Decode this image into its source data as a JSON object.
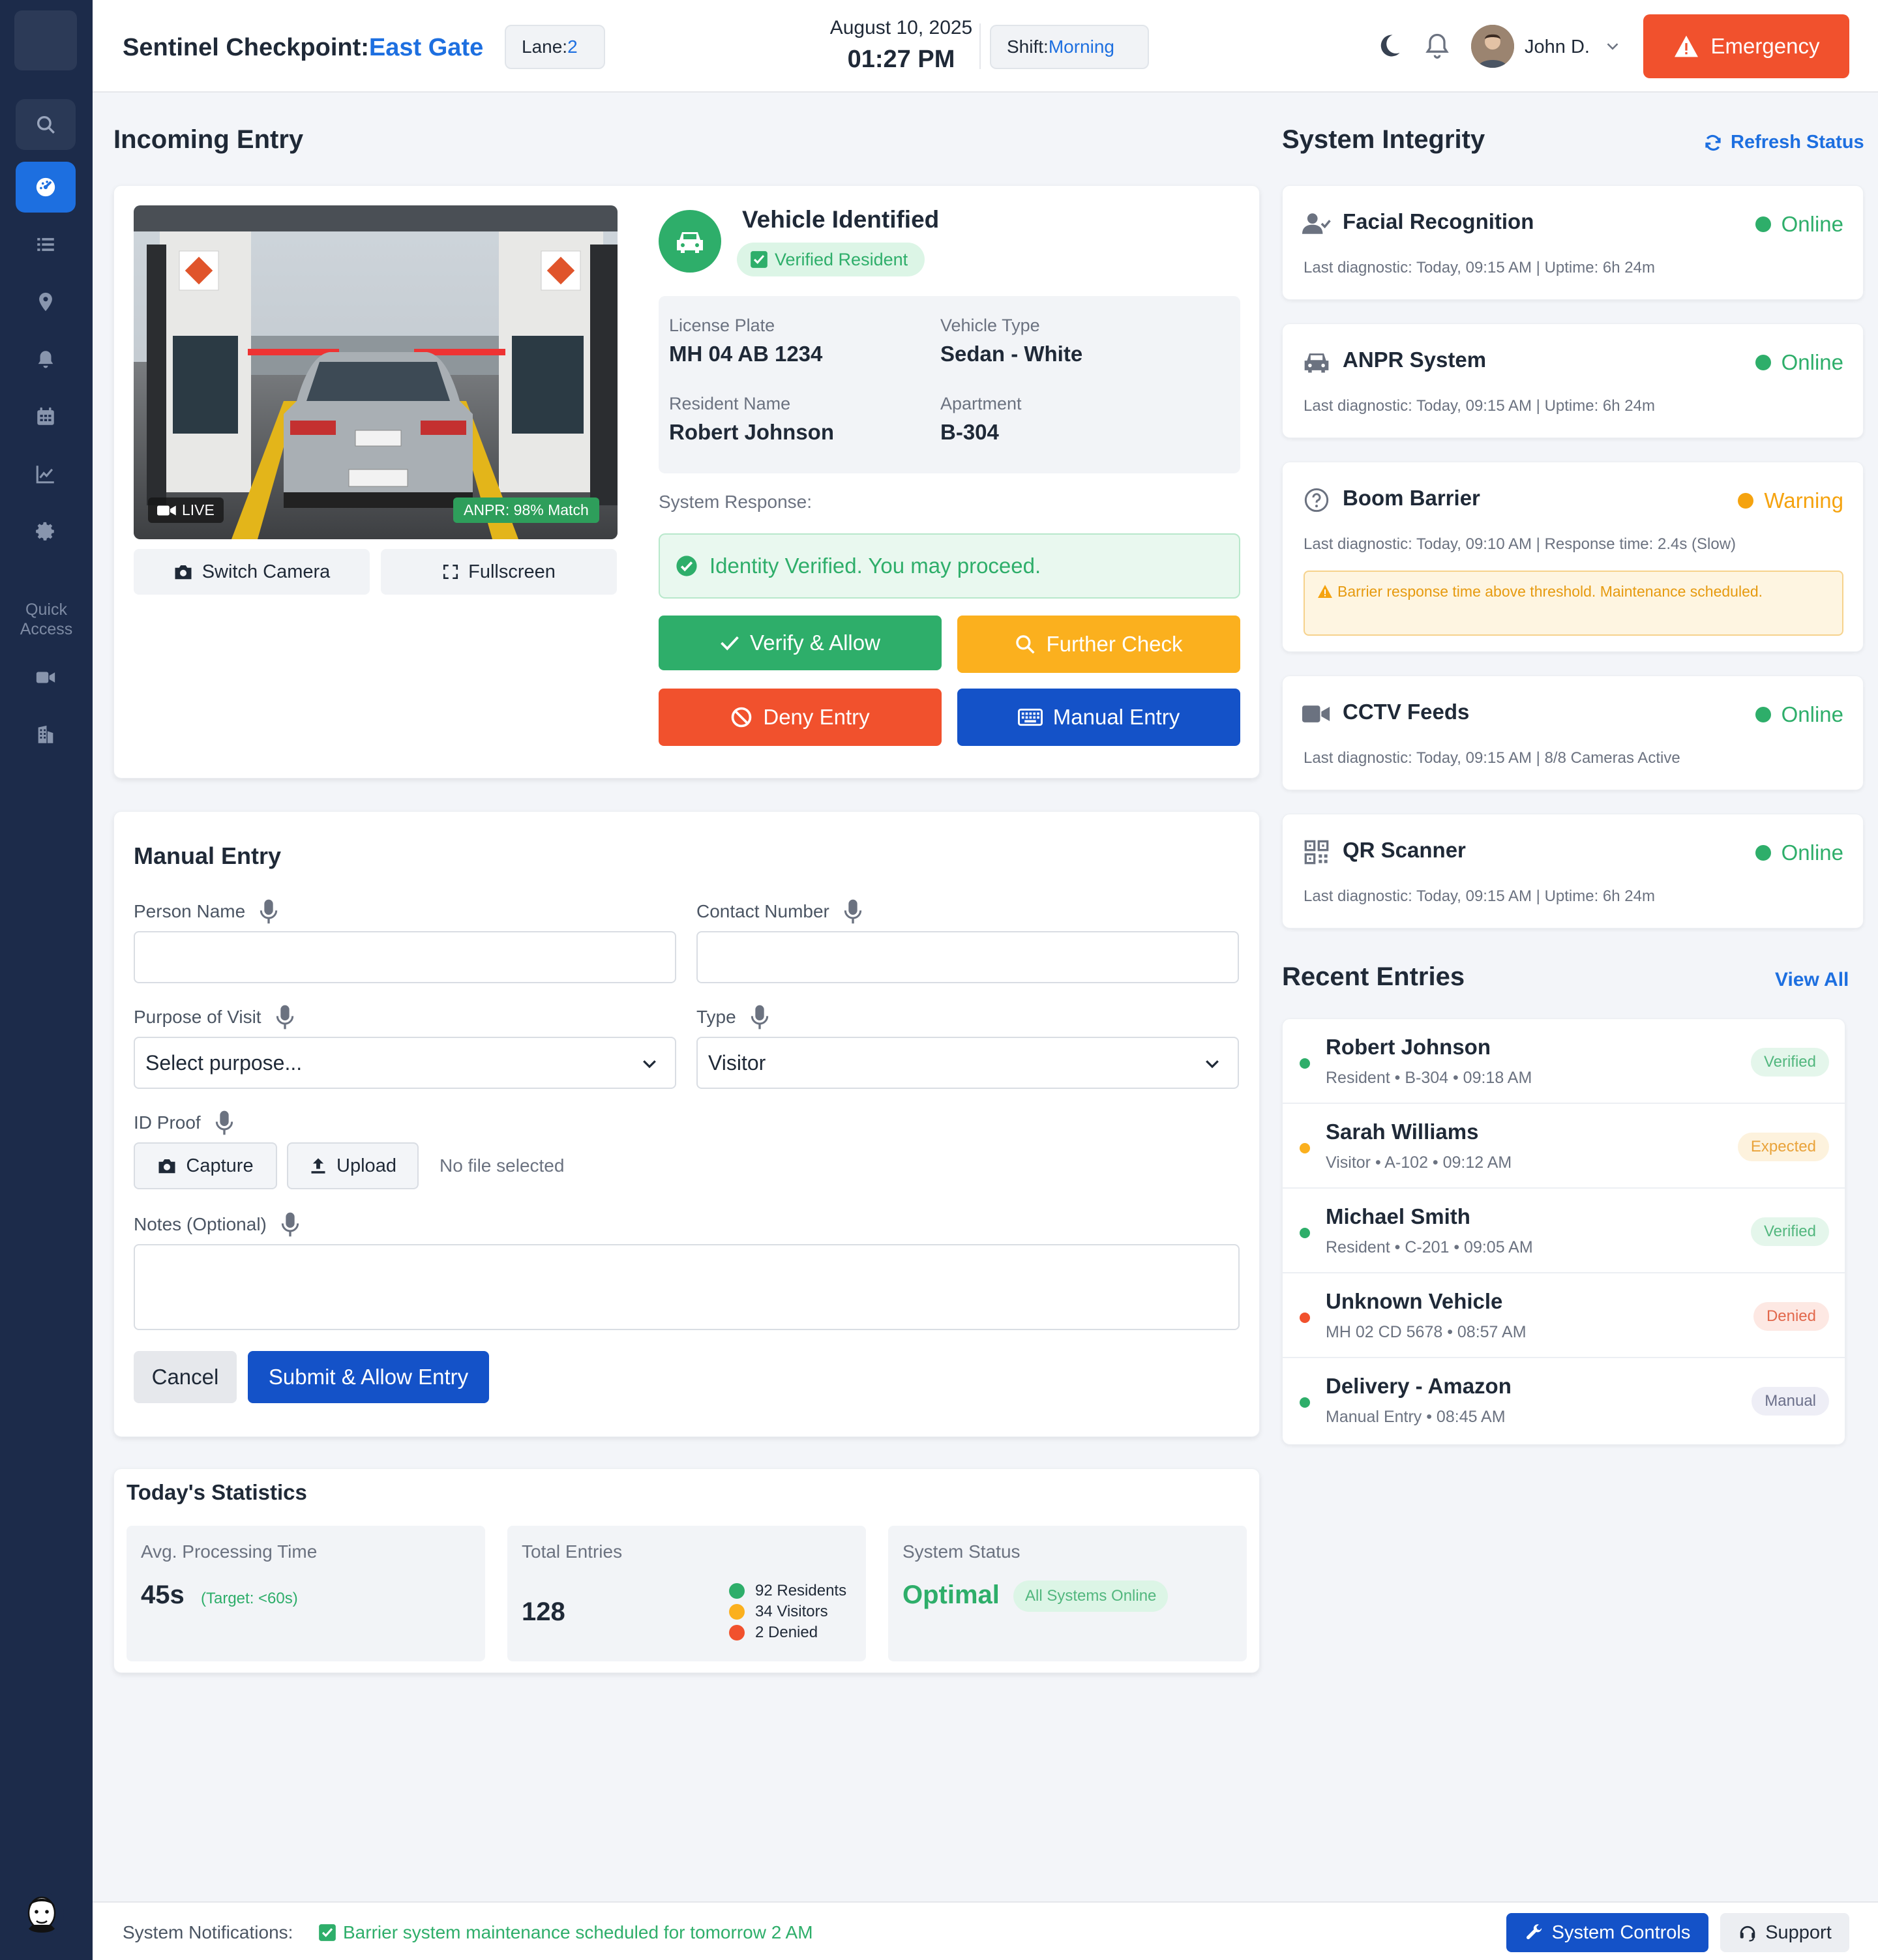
{
  "header": {
    "title_prefix": "Sentinel Checkpoint:",
    "title_location": "East Gate",
    "lane_label": "Lane:",
    "lane_value": "2",
    "date": "August 10, 2025",
    "time": "01:27 PM",
    "shift_label": "Shift:",
    "shift_value": "Morning",
    "user_name": "John D.",
    "emergency_label": "Emergency"
  },
  "sidebar": {
    "quick_access_label": "Quick Access",
    "items": [
      "search-icon",
      "dashboard-icon",
      "list-icon",
      "location-icon",
      "bell-icon",
      "calendar-icon",
      "chart-icon",
      "gear-icon",
      "video-icon",
      "building-icon"
    ]
  },
  "incoming": {
    "section_title": "Incoming Entry",
    "camera": {
      "live_label": "LIVE",
      "anpr_label": "ANPR: 98% Match",
      "switch_label": "Switch Camera",
      "fullscreen_label": "Fullscreen"
    },
    "vehicle_title": "Vehicle Identified",
    "verified_badge": "Verified Resident",
    "fields": {
      "plate_label": "License Plate",
      "plate_value": "MH 04 AB 1234",
      "type_label": "Vehicle Type",
      "type_value": "Sedan - White",
      "resident_label": "Resident Name",
      "resident_value": "Robert Johnson",
      "apartment_label": "Apartment",
      "apartment_value": "B-304"
    },
    "system_response_label": "System Response:",
    "system_response_msg": "Identity Verified. You may proceed.",
    "actions": {
      "verify": "Verify & Allow",
      "further": "Further Check",
      "deny": "Deny Entry",
      "manual": "Manual Entry"
    },
    "colors": {
      "verify": "#2eae6a",
      "further": "#fbb01e",
      "deny": "#f1512d",
      "manual": "#1452c8"
    }
  },
  "manual_entry": {
    "title": "Manual Entry",
    "person_name_label": "Person Name",
    "person_name_value": "",
    "contact_label": "Contact Number",
    "contact_value": "",
    "purpose_label": "Purpose of Visit",
    "purpose_value": "Select purpose...",
    "type_label": "Type",
    "type_value": "Visitor",
    "id_proof_label": "ID Proof",
    "capture_label": "Capture",
    "upload_label": "Upload",
    "no_file_label": "No file selected",
    "notes_label": "Notes (Optional)",
    "notes_value": "",
    "cancel_label": "Cancel",
    "submit_label": "Submit & Allow Entry"
  },
  "stats": {
    "title": "Today's Statistics",
    "avg_label": "Avg. Processing Time",
    "avg_value": "45s",
    "avg_target": "(Target: <60s)",
    "total_label": "Total Entries",
    "total_value": "128",
    "breakdown": [
      {
        "label": "92 Residents",
        "color": "#2eae6a"
      },
      {
        "label": "34 Visitors",
        "color": "#fbb01e"
      },
      {
        "label": "2 Denied",
        "color": "#f1512d"
      }
    ],
    "status_label": "System Status",
    "status_value": "Optimal",
    "status_badge": "All Systems Online"
  },
  "integrity": {
    "title": "System Integrity",
    "refresh_label": "Refresh Status",
    "systems": [
      {
        "name": "Facial Recognition",
        "status": "Online",
        "diag": "Last diagnostic: Today, 09:15 AM | Uptime: 6h 24m",
        "color": "#2eae6a",
        "icon": "face-recognition-icon"
      },
      {
        "name": "ANPR System",
        "status": "Online",
        "diag": "Last diagnostic: Today, 09:15 AM | Uptime: 6h 24m",
        "color": "#2eae6a",
        "icon": "car-icon"
      },
      {
        "name": "Boom Barrier",
        "status": "Warning",
        "diag": "Last diagnostic: Today, 09:10 AM | Response time: 2.4s (Slow)",
        "color": "#f5a30f",
        "icon": "question-icon",
        "warning": "Barrier response time above threshold. Maintenance scheduled."
      },
      {
        "name": "CCTV Feeds",
        "status": "Online",
        "diag": "Last diagnostic: Today, 09:15 AM | 8/8 Cameras Active",
        "color": "#2eae6a",
        "icon": "video-icon"
      },
      {
        "name": "QR Scanner",
        "status": "Online",
        "diag": "Last diagnostic: Today, 09:15 AM | Uptime: 6h 24m",
        "color": "#2eae6a",
        "icon": "qr-icon"
      }
    ]
  },
  "recent": {
    "title": "Recent Entries",
    "view_all_label": "View All",
    "entries": [
      {
        "name": "Robert Johnson",
        "sub": "Resident • B-304 • 09:18 AM",
        "badge": "Verified",
        "dot": "#2eae6a",
        "badge_bg": "#e4f6eb",
        "badge_fg": "#52b77e"
      },
      {
        "name": "Sarah Williams",
        "sub": "Visitor • A-102 • 09:12 AM",
        "badge": "Expected",
        "dot": "#fbb01e",
        "badge_bg": "#fdf2dd",
        "badge_fg": "#e9a33a"
      },
      {
        "name": "Michael Smith",
        "sub": "Resident • C-201 • 09:05 AM",
        "badge": "Verified",
        "dot": "#2eae6a",
        "badge_bg": "#e4f6eb",
        "badge_fg": "#52b77e"
      },
      {
        "name": "Unknown Vehicle",
        "sub": "MH 02 CD 5678 • 08:57 AM",
        "badge": "Denied",
        "dot": "#f1512d",
        "badge_bg": "#fde8e3",
        "badge_fg": "#e2684c"
      },
      {
        "name": "Delivery - Amazon",
        "sub": "Manual Entry • 08:45 AM",
        "badge": "Manual",
        "dot": "#2eae6a",
        "badge_bg": "#eeeef6",
        "badge_fg": "#6b6f8a"
      }
    ]
  },
  "bottom": {
    "notif_label": "System Notifications:",
    "notif_msg": "Barrier system maintenance scheduled for tomorrow 2 AM",
    "controls_label": "System Controls",
    "support_label": "Support"
  }
}
